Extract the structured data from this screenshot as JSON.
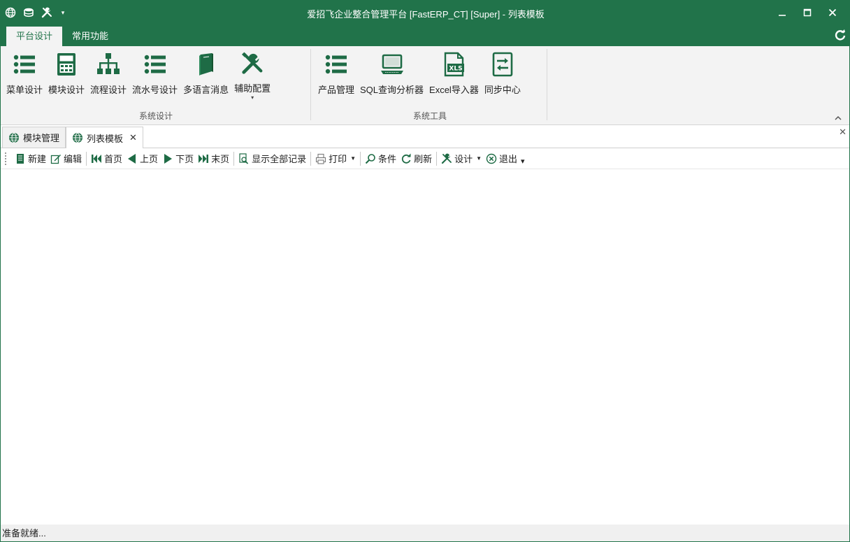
{
  "window": {
    "title": "爱招飞企业整合管理平台 [FastERP_CT] [Super] - 列表模板"
  },
  "colors": {
    "accent": "#21734a",
    "icon_green": "#1e6b45",
    "ribbon_bg": "#f3f3f3"
  },
  "quick_access": {
    "items": [
      "globe-icon",
      "database-icon",
      "tools-icon",
      "customize-dropdown-icon"
    ]
  },
  "ribbon": {
    "tabs": [
      {
        "label": "平台设计",
        "active": true
      },
      {
        "label": "常用功能",
        "active": false
      }
    ],
    "groups": [
      {
        "name": "系统设计",
        "buttons": [
          {
            "label": "菜单设计",
            "icon": "list-icon"
          },
          {
            "label": "模块设计",
            "icon": "calculator-icon"
          },
          {
            "label": "流程设计",
            "icon": "org-chart-icon"
          },
          {
            "label": "流水号设计",
            "icon": "list-icon"
          },
          {
            "label": "多语言消息",
            "icon": "book-icon"
          },
          {
            "label": "辅助配置",
            "icon": "tools-icon",
            "has_dropdown": true
          }
        ]
      },
      {
        "name": "系统工具",
        "buttons": [
          {
            "label": "产品管理",
            "icon": "list-icon"
          },
          {
            "label": "SQL查询分析器",
            "icon": "laptop-icon"
          },
          {
            "label": "Excel导入器",
            "icon": "xls-icon"
          },
          {
            "label": "同步中心",
            "icon": "sync-icon"
          }
        ]
      }
    ]
  },
  "doc_tabs": [
    {
      "label": "模块管理",
      "active": false,
      "closable": false
    },
    {
      "label": "列表模板",
      "active": true,
      "closable": true
    }
  ],
  "toolbar": {
    "new": "新建",
    "edit": "编辑",
    "first": "首页",
    "prev": "上页",
    "next": "下页",
    "last": "末页",
    "show_all": "显示全部记录",
    "print": "打印",
    "filter": "条件",
    "refresh": "刷新",
    "design": "设计",
    "exit": "退出"
  },
  "status": {
    "text": "准备就绪..."
  }
}
